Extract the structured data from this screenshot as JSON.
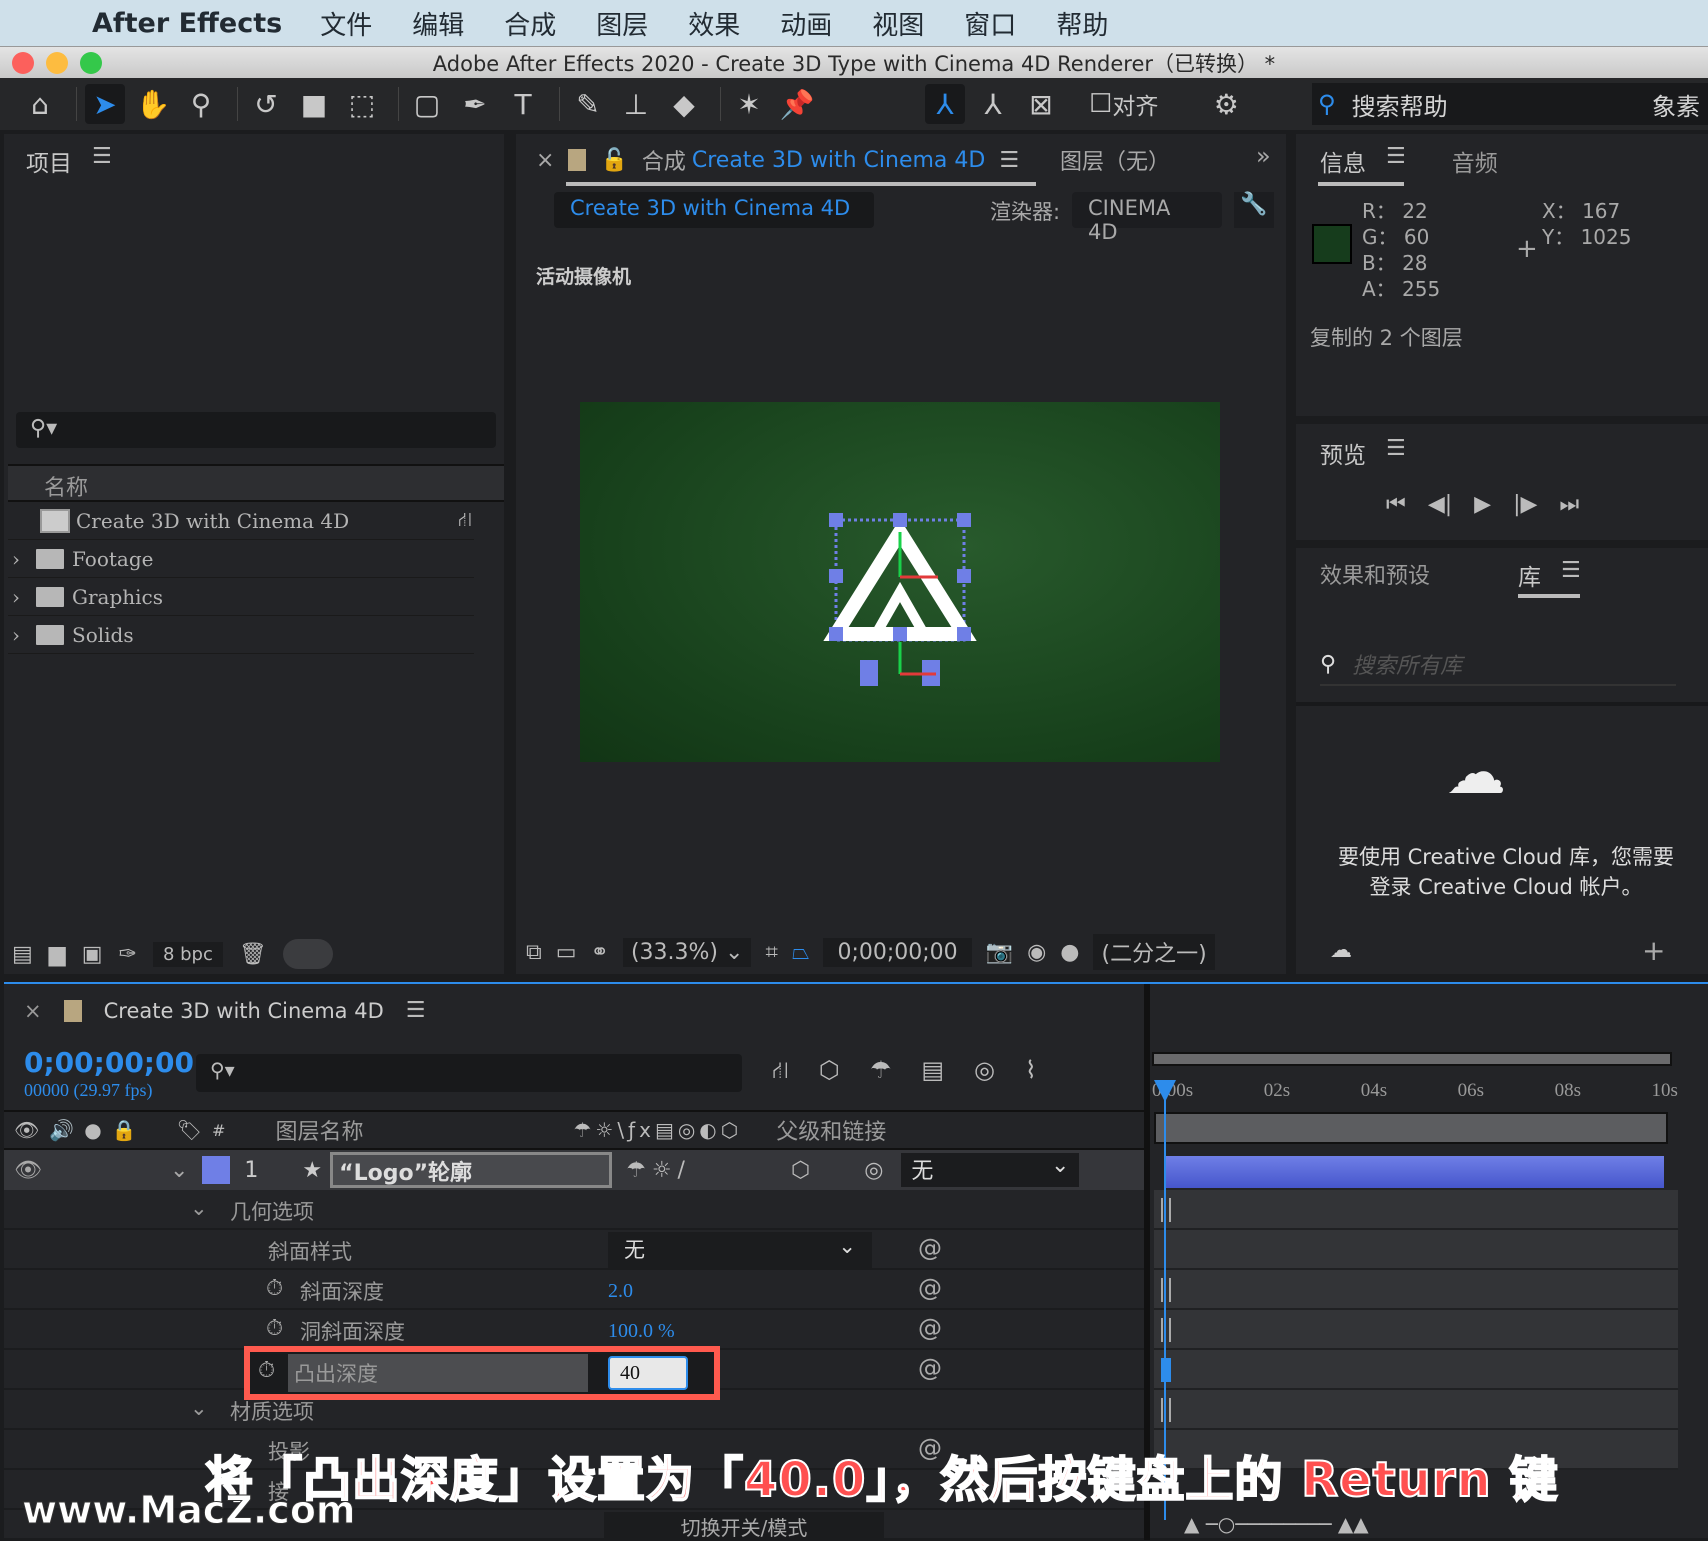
{
  "menubar": {
    "app": "After Effects",
    "items": [
      "文件",
      "编辑",
      "合成",
      "图层",
      "效果",
      "动画",
      "视图",
      "窗口",
      "帮助"
    ]
  },
  "window": {
    "title": "Adobe After Effects 2020 - Create 3D Type with Cinema 4D Renderer（已转换） *"
  },
  "toolbar": {
    "align_label": "对齐",
    "search_help": "搜索帮助",
    "extra": "象素"
  },
  "project": {
    "title": "项目",
    "search_placeholder": "",
    "column_name": "名称",
    "items": [
      {
        "name": "Create 3D with Cinema 4D",
        "type": "composition"
      },
      {
        "name": "Footage",
        "type": "folder"
      },
      {
        "name": "Graphics",
        "type": "folder"
      },
      {
        "name": "Solids",
        "type": "folder"
      }
    ],
    "bpc": "8 bpc"
  },
  "comp": {
    "tab_prefix": "合成",
    "tab_name": "Create 3D with Cinema 4D",
    "layer_tab": "图层（无）",
    "breadcrumb": "Create 3D with Cinema 4D",
    "renderer_label": "渲染器:",
    "renderer": "CINEMA 4D",
    "camera": "活动摄像机",
    "zoom": "(33.3%)",
    "timecode": "0;00;00;00",
    "resolution": "(二分之一)"
  },
  "info": {
    "tab": "信息",
    "tab2": "音频",
    "r": "22",
    "g": "60",
    "b": "28",
    "a": "255",
    "x": "167",
    "y": "1025",
    "swatch": "#163c1c",
    "message": "复制的 2 个图层"
  },
  "preview": {
    "title": "预览"
  },
  "library": {
    "tab1": "效果和预设",
    "tab2": "库",
    "search_placeholder": "搜索所有库",
    "message_line1": "要使用 Creative Cloud 库，您需要",
    "message_line2": "登录 Creative Cloud 帐户。"
  },
  "timeline": {
    "comp_name": "Create 3D with Cinema 4D",
    "timecode": "0;00;00;00",
    "frames": "00000 (29.97 fps)",
    "col_layer_name": "图层名称",
    "col_parent": "父级和链接",
    "ruler": [
      "0:00s",
      "02s",
      "04s",
      "06s",
      "08s",
      "10s"
    ],
    "layer": {
      "index": "1",
      "name": "“Logo”轮廓",
      "parent": "无",
      "color": "#6f7fe6"
    },
    "props": [
      {
        "label": "几何选项",
        "type": "group"
      },
      {
        "label": "斜面样式",
        "value": "无",
        "type": "select"
      },
      {
        "label": "斜面深度",
        "value": "2.0"
      },
      {
        "label": "洞斜面深度",
        "value": "100.0 %"
      },
      {
        "label": "凸出深度",
        "value": "40",
        "editing": true
      },
      {
        "label": "材质选项",
        "type": "group"
      },
      {
        "label": "投影",
        "value": ""
      },
      {
        "label": "接",
        "value": ""
      }
    ],
    "footer": "切换开关/模式"
  },
  "caption": "将「凸出深度」设置为「40.0」，然后按键盘上的 Return 键",
  "watermark": "www.MacZ.com"
}
